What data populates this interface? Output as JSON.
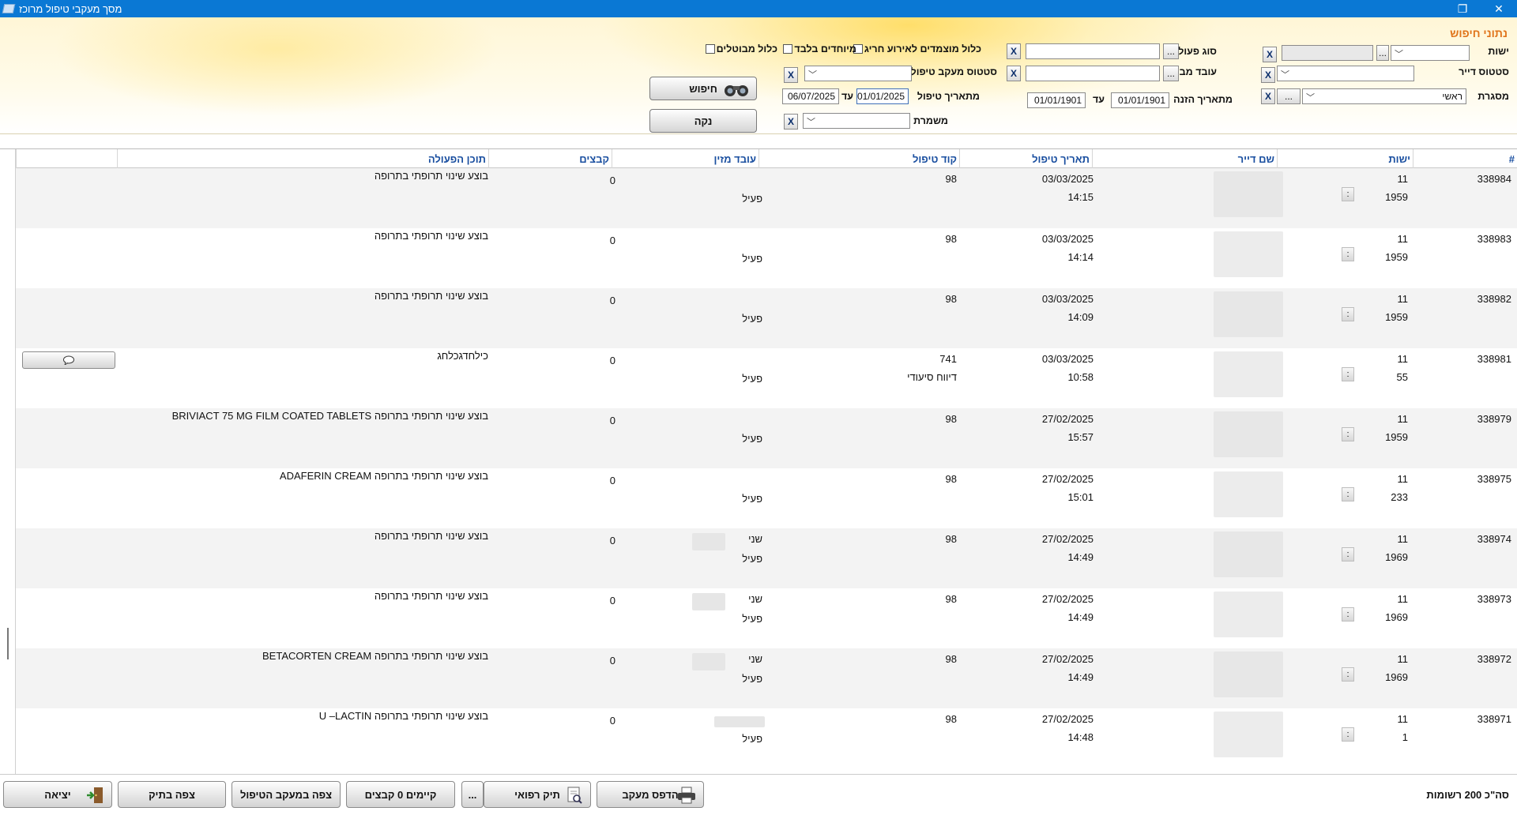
{
  "window": {
    "title": "מסך מעקבי טיפול מרוכז",
    "restore_glyph": "❐",
    "close_glyph": "✕"
  },
  "search": {
    "section_title": "נתוני חיפוש",
    "labels": {
      "branch": "ישות",
      "action_type": "סוג פעולה",
      "resident_status": "סטטוס דייר",
      "executing_worker": "עובד מבצע",
      "tracking_status": "סטטוס מעקב טיפול",
      "framework": "מסגרת",
      "entry_date_from": "מתאריך הזנה",
      "to": "עד",
      "treatment_date_from": "מתאריך טיפול",
      "treatment_to": "עד",
      "shift": "משמרת"
    },
    "checkboxes": {
      "include_special_event": "כלול מוצמדים לאירוע חריג",
      "special_only": "מיוחדים בלבד",
      "include_cancelled": "כלול מבוטלים"
    },
    "values": {
      "framework": "ראשי",
      "entry_date_from": "01/01/1901",
      "entry_date_to": "01/01/1901",
      "treatment_date_from": "01/01/2025",
      "treatment_date_to": "06/07/2025"
    },
    "x_label": "X",
    "dots_label": "...",
    "dots_small": "...",
    "search_button": "חיפוש",
    "clear_button": "נקה"
  },
  "grid": {
    "columns": {
      "id": "#",
      "branch": "ישות",
      "resident_name": "שם דייר",
      "treatment_date": "תאריך טיפול",
      "treatment_code": "קוד טיפול",
      "entering_worker": "עובד מזין",
      "files": "קבצים",
      "action_content": "תוכן הפעולה"
    },
    "rows": [
      {
        "id": "338984",
        "branch": "11",
        "sub": "1959",
        "date": "03/03/2025",
        "time": "14:15",
        "code": "98",
        "code_desc": "",
        "worker": "",
        "status": "פעיל",
        "files": "0",
        "content": "בוצע שינוי תרופתי בתרופה",
        "dot": ":"
      },
      {
        "id": "338983",
        "branch": "11",
        "sub": "1959",
        "date": "03/03/2025",
        "time": "14:14",
        "code": "98",
        "code_desc": "",
        "worker": "",
        "status": "פעיל",
        "files": "0",
        "content": "בוצע שינוי תרופתי בתרופה",
        "dot": ":"
      },
      {
        "id": "338982",
        "branch": "11",
        "sub": "1959",
        "date": "03/03/2025",
        "time": "14:09",
        "code": "98",
        "code_desc": "",
        "worker": "",
        "status": "פעיל",
        "files": "0",
        "content": "בוצע שינוי תרופתי בתרופה",
        "dot": ":"
      },
      {
        "id": "338981",
        "branch": "11",
        "sub": "55",
        "date": "03/03/2025",
        "time": "10:58",
        "code": "741",
        "code_desc": "דיווח סיעודי",
        "worker": "",
        "status": "פעיל",
        "files": "0",
        "content": "כילחדגכלחג",
        "dot": ":"
      },
      {
        "id": "338979",
        "branch": "11",
        "sub": "1959",
        "date": "27/02/2025",
        "time": "15:57",
        "code": "98",
        "code_desc": "",
        "worker": "",
        "status": "פעיל",
        "files": "0",
        "content": "בוצע שינוי תרופתי בתרופה BRIVIACT 75 MG FILM COATED TABLETS",
        "dot": ":"
      },
      {
        "id": "338975",
        "branch": "11",
        "sub": "233",
        "date": "27/02/2025",
        "time": "15:01",
        "code": "98",
        "code_desc": "",
        "worker": "",
        "status": "פעיל",
        "files": "0",
        "content": "בוצע שינוי תרופתי בתרופה ADAFERIN CREAM",
        "dot": ":"
      },
      {
        "id": "338974",
        "branch": "11",
        "sub": "1969",
        "date": "27/02/2025",
        "time": "14:49",
        "code": "98",
        "code_desc": "",
        "worker": "שני",
        "status": "פעיל",
        "files": "0",
        "content": "בוצע שינוי תרופתי בתרופה",
        "dot": ":"
      },
      {
        "id": "338973",
        "branch": "11",
        "sub": "1969",
        "date": "27/02/2025",
        "time": "14:49",
        "code": "98",
        "code_desc": "",
        "worker": "שני",
        "status": "פעיל",
        "files": "0",
        "content": "בוצע שינוי תרופתי בתרופה",
        "dot": ":"
      },
      {
        "id": "338972",
        "branch": "11",
        "sub": "1969",
        "date": "27/02/2025",
        "time": "14:49",
        "code": "98",
        "code_desc": "",
        "worker": "שני",
        "status": "פעיל",
        "files": "0",
        "content": "בוצע שינוי תרופתי בתרופה BETACORTEN CREAM",
        "dot": ":"
      },
      {
        "id": "338971",
        "branch": "11",
        "sub": "1",
        "date": "27/02/2025",
        "time": "14:48",
        "code": "98",
        "code_desc": "",
        "worker": "",
        "status": "פעיל",
        "files": "0",
        "content": "בוצע שינוי תרופתי בתרופה U –LACTIN",
        "dot": ":"
      }
    ]
  },
  "footer": {
    "exit": "יציאה",
    "view_file": "צפה בתיק",
    "view_tracking": "צפה במעקב הטיפול",
    "existing_files": "קיימים 0 קבצים",
    "more": "...",
    "medical_file": "תיק רפואי",
    "print_tracking": "הדפס מעקב",
    "total": "סה\"כ 200 רשומות"
  },
  "colors": {
    "titlebar": "#0a78d4",
    "section_title": "#e0741a",
    "column_header": "#1a4fa0"
  }
}
